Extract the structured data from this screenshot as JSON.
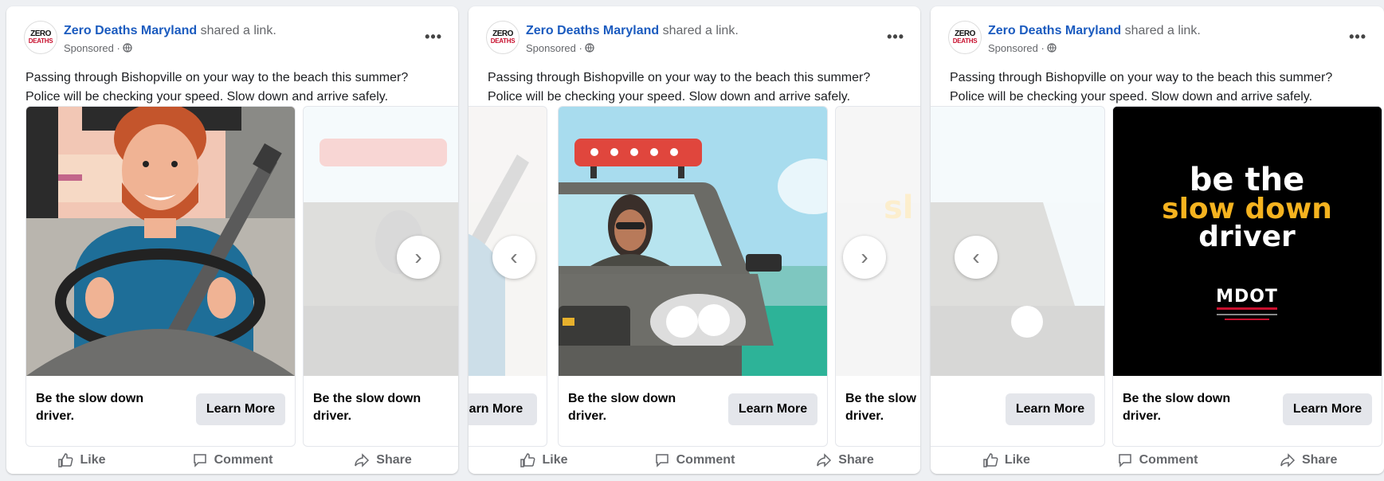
{
  "posts": [
    {
      "page_name": "Zero Deaths Maryland",
      "shared": "shared a link.",
      "sponsored": "Sponsored ·",
      "more": "•••",
      "caption_line1": "Passing through Bishopville on your way to the beach this summer?",
      "caption_line2": "Police will be checking your speed. Slow down and arrive safely.",
      "logo_top": "ZERO",
      "logo_bottom": "DEATHS",
      "cards": [
        {
          "title": "Be the slow down driver.",
          "cta": "Learn More"
        },
        {
          "title": "Be the slow down driver.",
          "cta": ""
        }
      ]
    },
    {
      "page_name": "Zero Deaths Maryland",
      "shared": "shared a link.",
      "sponsored": "Sponsored ·",
      "more": "•••",
      "caption_line1": "Passing through Bishopville on your way to the beach this summer?",
      "caption_line2": "Police will be checking your speed. Slow down and arrive safely.",
      "logo_top": "ZERO",
      "logo_bottom": "DEATHS",
      "cards": [
        {
          "title": "",
          "cta": "earn More"
        },
        {
          "title": "Be the slow down driver.",
          "cta": "Learn More"
        },
        {
          "title": "Be the slow driver.",
          "cta": ""
        }
      ]
    },
    {
      "page_name": "Zero Deaths Maryland",
      "shared": "shared a link.",
      "sponsored": "Sponsored ·",
      "more": "•••",
      "caption_line1": "Passing through Bishopville on your way to the beach this summer?",
      "caption_line2": "Police will be checking your speed. Slow down and arrive safely.",
      "logo_top": "ZERO",
      "logo_bottom": "DEATHS",
      "cards": [
        {
          "title": "",
          "cta": "Learn More"
        },
        {
          "title": "Be the slow down driver.",
          "cta": "Learn More"
        }
      ]
    }
  ],
  "poster": {
    "line1": "be the",
    "line2": "slow down",
    "line3": "driver",
    "brand": "MDOT"
  },
  "actions": {
    "like": "Like",
    "comment": "Comment",
    "share": "Share"
  },
  "icons": {
    "like": "thumbs-up-icon",
    "comment": "comment-bubble-icon",
    "share": "share-arrow-icon",
    "prev": "chevron-left-icon",
    "next": "chevron-right-icon",
    "privacy": "globe-icon"
  },
  "colors": {
    "brand_link": "#1b5bbf",
    "muted": "#65676b",
    "button_bg": "#e4e6eb",
    "poster_accent": "#f5b31f"
  }
}
